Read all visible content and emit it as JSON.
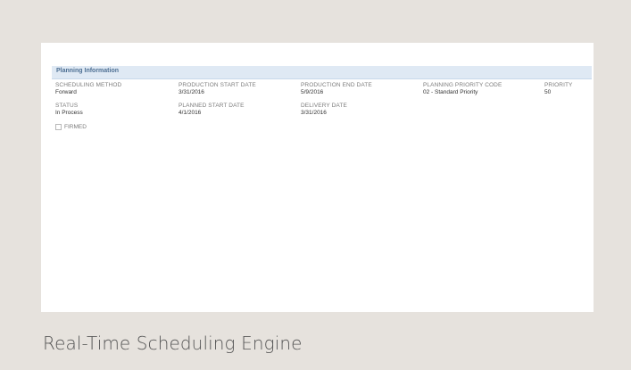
{
  "planning_info": {
    "title": "Planning Information",
    "fields": [
      {
        "label": "SCHEDULING METHOD",
        "value": "Forward"
      },
      {
        "label": "PRODUCTION START DATE",
        "value": "3/31/2016"
      },
      {
        "label": "PRODUCTION END DATE",
        "value": "5/9/2016"
      },
      {
        "label": "PLANNING PRIORITY CODE",
        "value": "02 - Standard Priority"
      },
      {
        "label": "PRIORITY",
        "value": "50"
      },
      {
        "label": "STATUS",
        "value": "In Process"
      },
      {
        "label": "PLANNED START DATE",
        "value": "4/1/2016"
      },
      {
        "label": "DELIVERY DATE",
        "value": "3/31/2016"
      }
    ],
    "firmed": {
      "label": "FIRMED",
      "checked": false
    }
  },
  "caption": "Real-Time Scheduling Engine",
  "colors": {
    "page_background": "#e6e2dd",
    "panel_background": "#ffffff",
    "header_background": "#dfe9f4",
    "header_text": "#4d6f93"
  }
}
